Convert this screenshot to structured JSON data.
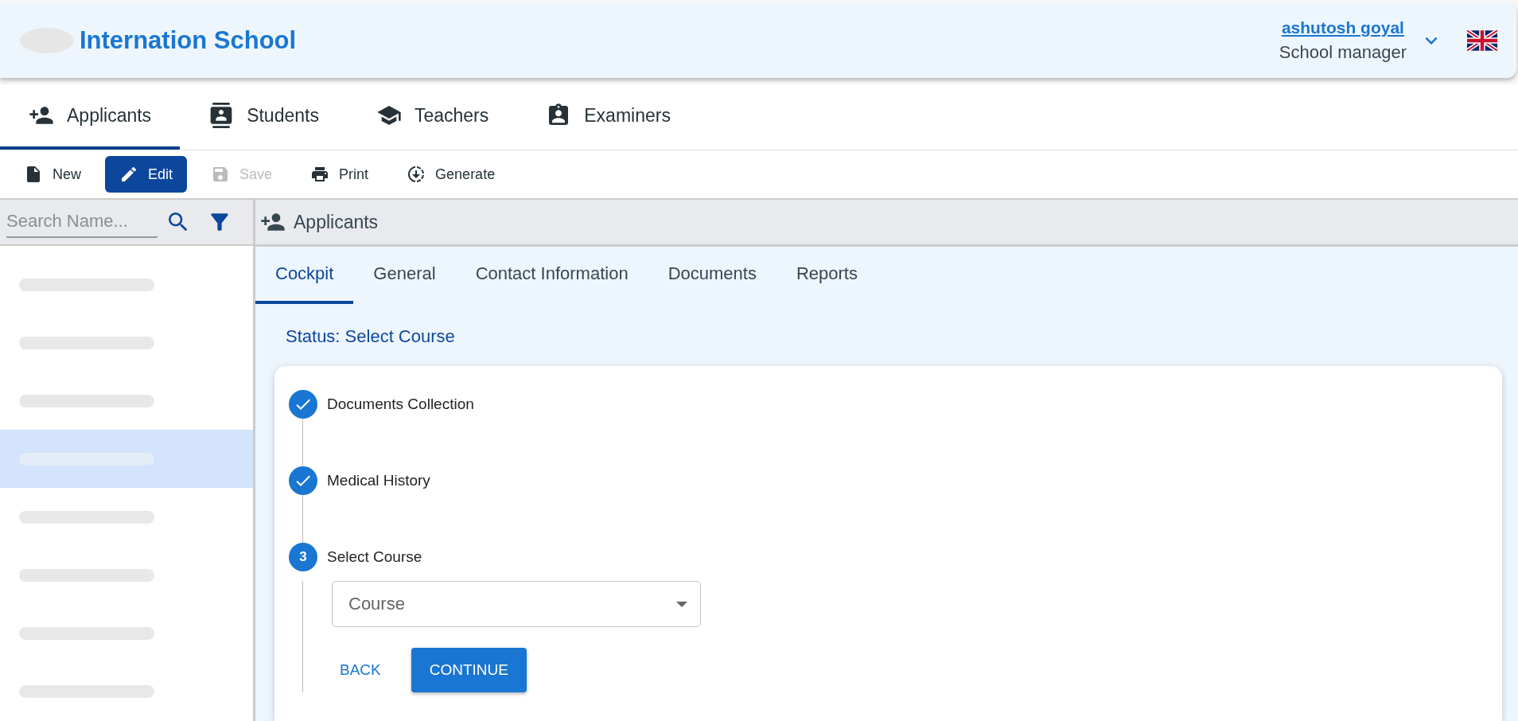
{
  "header": {
    "title": "Internation School",
    "user_name": "ashutosh goyal",
    "user_role": "School manager"
  },
  "main_tabs": [
    {
      "label": "Applicants",
      "kind": "applicants",
      "selected": true
    },
    {
      "label": "Students",
      "kind": "students",
      "selected": false
    },
    {
      "label": "Teachers",
      "kind": "teachers",
      "selected": false
    },
    {
      "label": "Examiners",
      "kind": "examiners",
      "selected": false
    }
  ],
  "toolbar": [
    {
      "label": "New",
      "kind": "new",
      "primary": false,
      "disabled": false
    },
    {
      "label": "Edit",
      "kind": "edit",
      "primary": true,
      "disabled": false
    },
    {
      "label": "Save",
      "kind": "save",
      "primary": false,
      "disabled": true
    },
    {
      "label": "Print",
      "kind": "print",
      "primary": false,
      "disabled": false
    },
    {
      "label": "Generate",
      "kind": "generate",
      "primary": false,
      "disabled": false
    }
  ],
  "sidebar": {
    "search": {
      "placeholder": "Search Name..."
    },
    "items": [
      {
        "selected": false
      },
      {
        "selected": false
      },
      {
        "selected": false
      },
      {
        "selected": true
      },
      {
        "selected": false
      },
      {
        "selected": false
      },
      {
        "selected": false
      },
      {
        "selected": false
      }
    ]
  },
  "panel": {
    "title": "Applicants",
    "tabs": [
      {
        "label": "Cockpit",
        "selected": true
      },
      {
        "label": "General",
        "selected": false
      },
      {
        "label": "Contact Information",
        "selected": false
      },
      {
        "label": "Documents",
        "selected": false
      },
      {
        "label": "Reports",
        "selected": false
      }
    ],
    "status": "Status: Select Course",
    "steps": [
      {
        "label": "Documents Collection",
        "kind": "completed"
      },
      {
        "label": "Medical History",
        "kind": "completed"
      },
      {
        "label": "Select Course",
        "kind": "active",
        "number": "3"
      }
    ],
    "course_select": {
      "placeholder": "Course"
    },
    "back_button": "BACK",
    "continue_button": "CONTINUE"
  }
}
